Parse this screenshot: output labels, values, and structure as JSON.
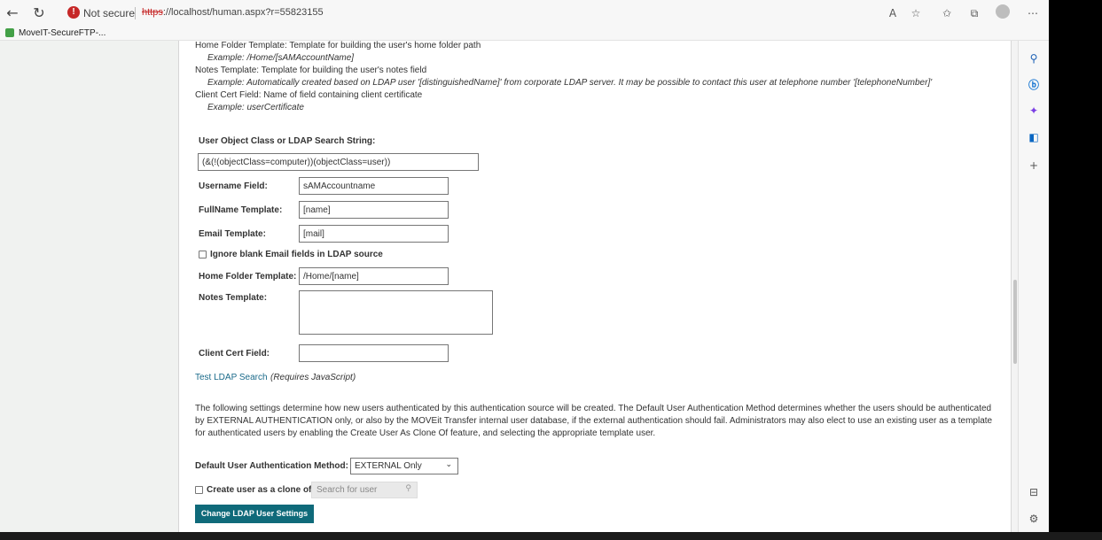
{
  "browser": {
    "not_secure": "Not secure",
    "url_scheme": "https",
    "url_rest": "://localhost/human.aspx?r=55823155",
    "bookmark": "MoveIT-SecureFTP-..."
  },
  "help": {
    "home_folder_partial": "Home Folder Template: Template for building the user's home folder path",
    "home_folder_example": "Example: /Home/[sAMAccountName]",
    "notes_desc": "Notes Template: Template for building the user's notes field",
    "notes_example": "Example: Automatically created based on LDAP user '[distinguishedName]' from corporate LDAP server.  It may be possible to contact this user at telephone number '[telephoneNumber]'",
    "cert_desc": "Client Cert Field: Name of field containing client certificate",
    "cert_example": "Example: userCertificate"
  },
  "form": {
    "object_class_label": "User Object Class or LDAP Search String:",
    "object_class_value": "(&(!(objectClass=computer))(objectClass=user))",
    "username_label": "Username Field:",
    "username_value": "sAMAccountname",
    "fullname_label": "FullName Template:",
    "fullname_value": "[name]",
    "email_label": "Email Template:",
    "email_value": "[mail]",
    "ignore_blank_label": "Ignore blank Email fields in LDAP source",
    "home_folder_label": "Home Folder Template:",
    "home_folder_value": "/Home/[name]",
    "notes_label": "Notes Template:",
    "cert_label": "Client Cert Field:",
    "cert_value": ""
  },
  "test_ldap": {
    "link": "Test LDAP Search",
    "note": "(Requires JavaScript)"
  },
  "settings_para": "The following settings determine how new users authenticated by this authentication source will be created. The Default User Authentication Method determines whether the users should be authenticated by EXTERNAL AUTHENTICATION only, or also by the MOVEit Transfer internal user database, if the external authentication should fail. Administrators may also elect to use an existing user as a template for authenticated users by enabling the Create User As Clone Of feature, and selecting the appropriate template user.",
  "auth_method": {
    "label": "Default User Authentication Method:",
    "value": "EXTERNAL Only"
  },
  "clone": {
    "label": "Create user as a clone of",
    "placeholder": "Search for user"
  },
  "submit_label": "Change LDAP User Settings"
}
